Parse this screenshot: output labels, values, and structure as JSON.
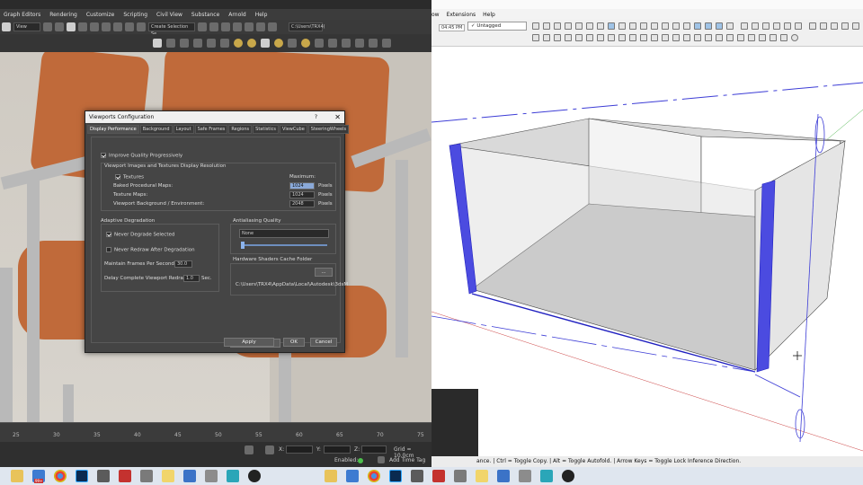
{
  "max": {
    "menu": [
      "Graph Editors",
      "Rendering",
      "Customize",
      "Scripting",
      "Civil View",
      "Substance",
      "Arnold",
      "Help"
    ],
    "toolbar": {
      "view_select": "View",
      "selection_set": "Create Selection Se",
      "path_field": "C:\\Users\\TRX4("
    },
    "timeline_ticks": [
      "25",
      "30",
      "35",
      "40",
      "45",
      "50",
      "55",
      "60",
      "65",
      "70",
      "75"
    ],
    "status": {
      "x_label": "X:",
      "y_label": "Y:",
      "z_label": "Z:",
      "grid": "Grid = 10.0cm",
      "enabled_label": "Enabled:",
      "add_time_tag": "Add Time Tag"
    }
  },
  "dialog": {
    "title": "Viewports Configuration",
    "help": "?",
    "close": "✕",
    "tabs": [
      "Display Performance",
      "Background",
      "Layout",
      "Safe Frames",
      "Regions",
      "Statistics",
      "ViewCube",
      "SteeringWheels"
    ],
    "improve_quality": "Improve Quality Progressively",
    "resolution_heading": "Viewport Images and Textures Display Resolution",
    "maximum_label": "Maximum:",
    "textures_label": "Textures",
    "baked_label": "Baked Procedural Maps:",
    "baked_value": "1024",
    "texture_maps_label": "Texture Maps:",
    "texture_maps_value": "1024",
    "bg_label": "Viewport Background / Environment:",
    "bg_value": "2048",
    "pixels": "Pixels",
    "adaptive_heading": "Adaptive Degradation",
    "never_degrade": "Never Degrade Selected",
    "never_redraw": "Never Redraw After Degradation",
    "maintain_fps_label": "Maintain Frames Per Second:",
    "maintain_fps_value": "30.0",
    "delay_label": "Delay Complete Viewport Redraw:",
    "delay_value": "1.0",
    "sec": "Sec.",
    "antialias_heading": "Antialiasing Quality",
    "antialias_value": "None",
    "cache_heading": "Hardware Shaders Cache Folder",
    "cache_browse": "...",
    "cache_path": "C:\\Users\\TRX4\\AppData\\Local\\Autodesk\\3dsM",
    "apply": "Apply",
    "ok": "OK",
    "cancel": "Cancel"
  },
  "sketchup": {
    "menu": [
      "ow",
      "Extensions",
      "Help"
    ],
    "time": "04:45 PM",
    "tag_select": "Untagged",
    "status_text": "ance. | Ctrl = Toggle Copy. | Alt = Toggle Autofold. | Arrow Keys = Toggle Lock Inference Direction."
  },
  "taskbar": {
    "badge": "99+",
    "icons": [
      "file-explorer-icon",
      "folder-icon",
      "chrome-icon",
      "photoshop-icon",
      "calculator-icon",
      "sketchup-icon",
      "unknown-app-icon",
      "notes-icon",
      "mail-icon",
      "generic-app-icon",
      "3dsmax-icon",
      "browser-icon"
    ]
  }
}
